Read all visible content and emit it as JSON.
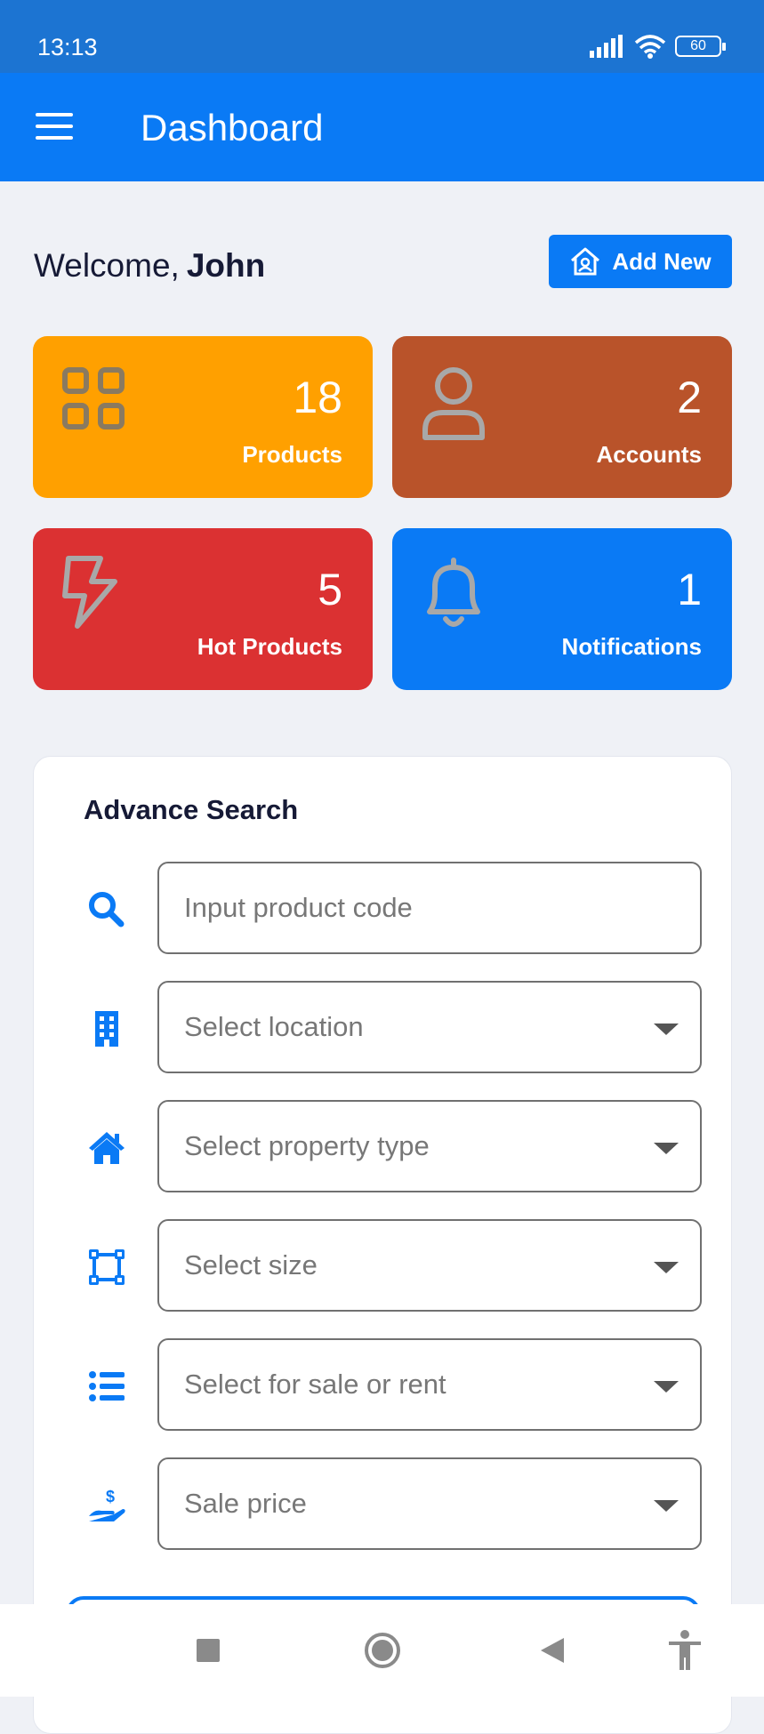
{
  "status_bar": {
    "time": "13:13",
    "battery": "60"
  },
  "app_bar": {
    "title": "Dashboard"
  },
  "welcome": {
    "greeting": "Welcome,",
    "name": "John"
  },
  "add_button": {
    "label": "Add New"
  },
  "stats": [
    {
      "value": "18",
      "label": "Products",
      "color": "#ffa000",
      "icon": "grid-icon"
    },
    {
      "value": "2",
      "label": "Accounts",
      "color": "#b9532a",
      "icon": "user-icon"
    },
    {
      "value": "5",
      "label": "Hot Products",
      "color": "#db3132",
      "icon": "lightning-icon"
    },
    {
      "value": "1",
      "label": "Notifications",
      "color": "#0a7af5",
      "icon": "bell-icon"
    }
  ],
  "advance_search": {
    "title": "Advance Search",
    "fields": [
      {
        "placeholder": "Input product code",
        "icon": "search-icon",
        "type": "input"
      },
      {
        "placeholder": "Select location",
        "icon": "building-icon",
        "type": "select"
      },
      {
        "placeholder": "Select property type",
        "icon": "home-icon",
        "type": "select"
      },
      {
        "placeholder": "Select size",
        "icon": "size-icon",
        "type": "select"
      },
      {
        "placeholder": "Select for sale or rent",
        "icon": "list-icon",
        "type": "select"
      },
      {
        "placeholder": "Sale price",
        "icon": "price-icon",
        "type": "select"
      }
    ]
  },
  "colors": {
    "primary": "#0a7af5",
    "status_bar": "#1c74d2",
    "background": "#eff1f6"
  }
}
